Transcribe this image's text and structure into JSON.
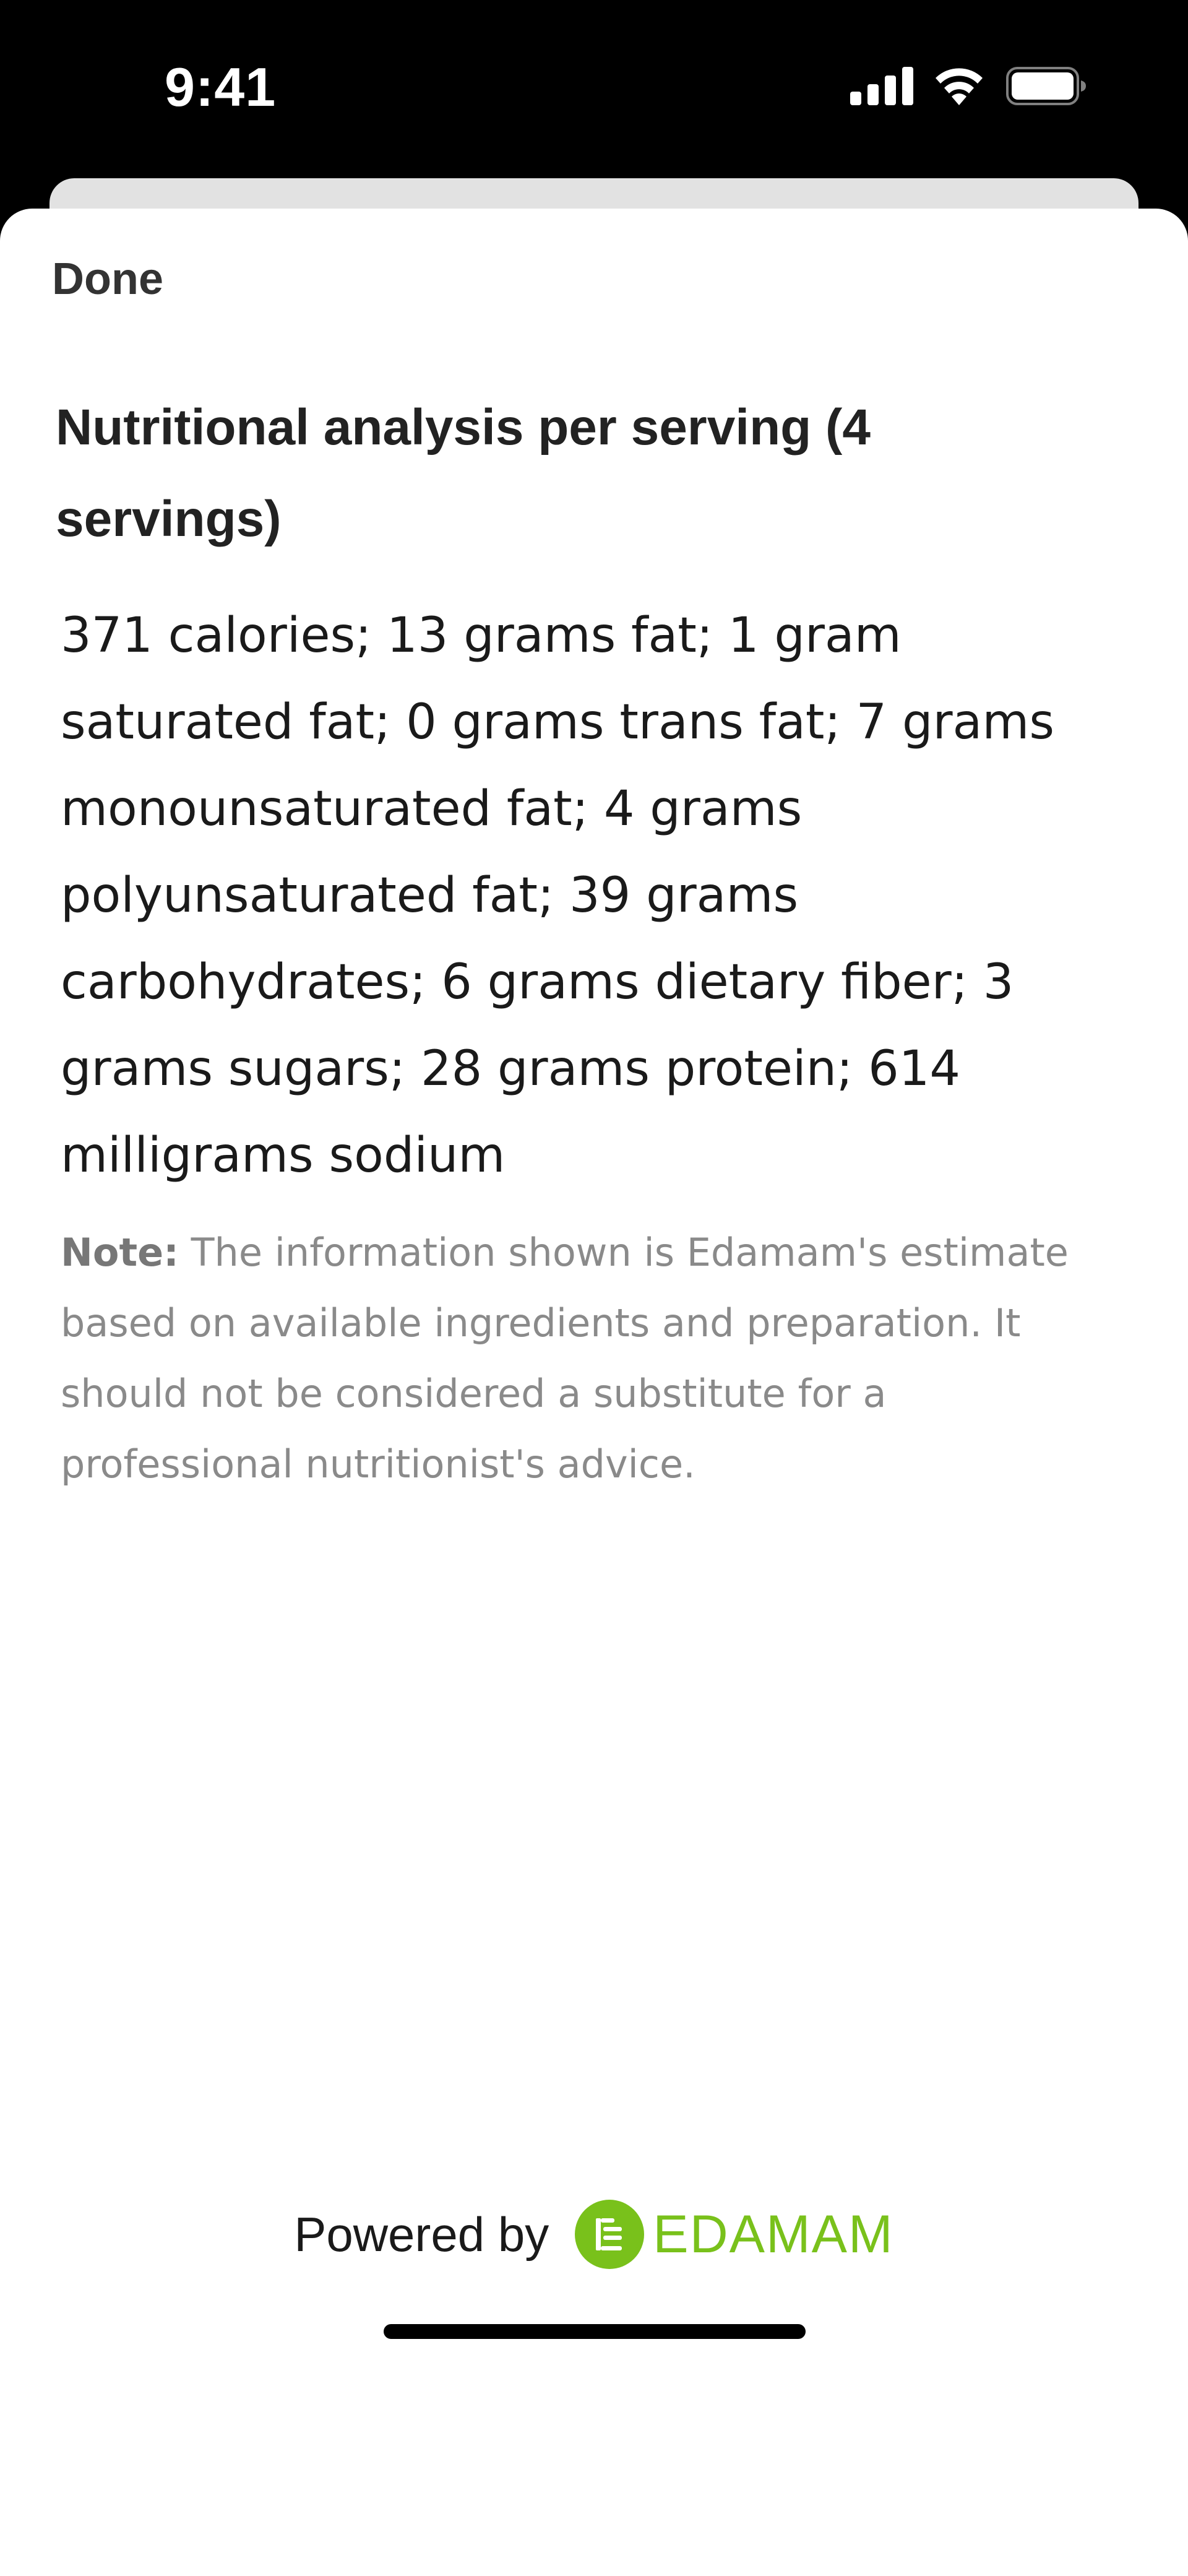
{
  "status_bar": {
    "time": "9:41"
  },
  "sheet": {
    "done_label": "Done",
    "title": "Nutritional analysis per serving (4 servings)",
    "nutrition_text": "371 calories; 13 grams fat; 1 gram saturated fat; 0 grams trans fat; 7 grams monounsaturated fat; 4 grams polyunsaturated fat; 39 grams carbohydrates; 6 grams dietary fiber; 3 grams sugars; 28 grams protein; 614 milligrams sodium",
    "note_label": "Note:",
    "note_text": " The information shown is Edamam's estimate based on available ingredients and preparation. It should not be considered a substitute for a professional nutritionist's advice."
  },
  "footer": {
    "powered_by": "Powered by",
    "brand": "EDAMAM",
    "brand_color": "#79c11b",
    "brand_icon": "edamam-logo-icon"
  },
  "icons": {
    "signal": "cellular-signal-icon",
    "wifi": "wifi-icon",
    "battery": "battery-icon"
  }
}
